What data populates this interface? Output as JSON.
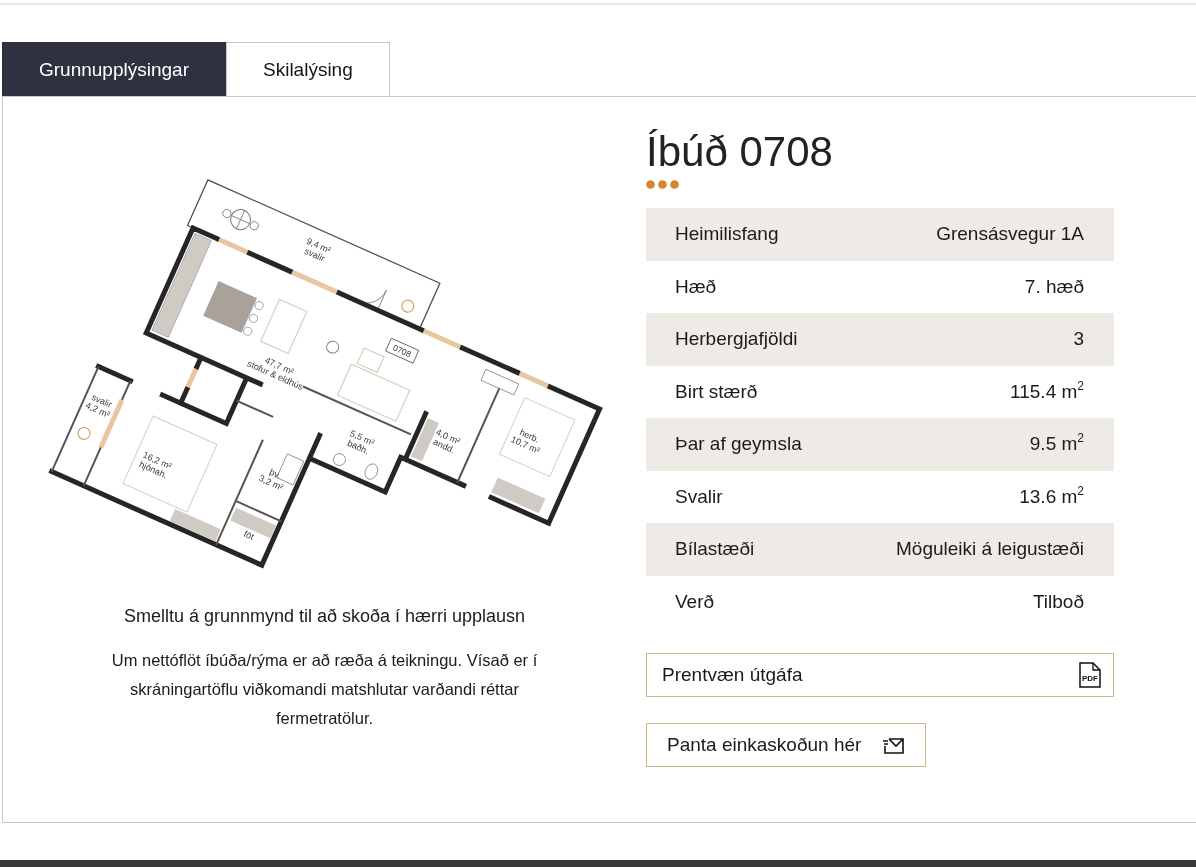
{
  "tabs": [
    {
      "label": "Grunnupplýsingar",
      "selected": true
    },
    {
      "label": "Skilalýsing",
      "selected": false
    }
  ],
  "floor_plan": {
    "rooms": [
      {
        "lines": [
          "9,4 m²",
          "svalir"
        ]
      },
      {
        "lines": [
          "47,7 m²",
          "stofur & eldhús"
        ]
      },
      {
        "lines": [
          "5,5 m²",
          "baðh."
        ]
      },
      {
        "lines": [
          "4,0 m²",
          "andd."
        ]
      },
      {
        "lines": [
          "herb.",
          "10,7 m²"
        ]
      },
      {
        "lines": [
          "svalir",
          "4,2 m²"
        ]
      },
      {
        "lines": [
          "16,2 m²",
          "hjónah."
        ]
      },
      {
        "lines": [
          "þv.",
          "3,2 m²"
        ]
      },
      {
        "lines": [
          "föt"
        ]
      }
    ],
    "unit_tag": "0708"
  },
  "floor_plan_hint": "Smelltu á grunnmynd til að skoða í hærri upplausn",
  "disclaimer": "Um nettóflöt íbúða/rýma er að ræða á teikningu. Vísað er í skráningartöflu viðkomandi matshlutar varðandi réttar fermetratölur.",
  "title": "Íbúð 0708",
  "details": [
    {
      "label": "Heimilisfang",
      "value": "Grensásvegur 1A"
    },
    {
      "label": "Hæð",
      "value": "7. hæð"
    },
    {
      "label": "Herbergjafjöldi",
      "value": "3"
    },
    {
      "label": "Birt stærð",
      "value": "115.4 m$^{2}$"
    },
    {
      "label": "Þar af geymsla",
      "value": "9.5 m$^{2}$"
    },
    {
      "label": "Svalir",
      "value": "13.6 m$^{2}$"
    },
    {
      "label": "Bílastæði",
      "value": "Möguleiki á leigustæði"
    },
    {
      "label": "Verð",
      "value": "Tilboð"
    }
  ],
  "buttons": [
    {
      "kind": "print",
      "label": "Prentvæn útgáfa",
      "icon_label": "PDF"
    },
    {
      "kind": "booking",
      "label": "Panta einkaskoðun hér"
    }
  ]
}
